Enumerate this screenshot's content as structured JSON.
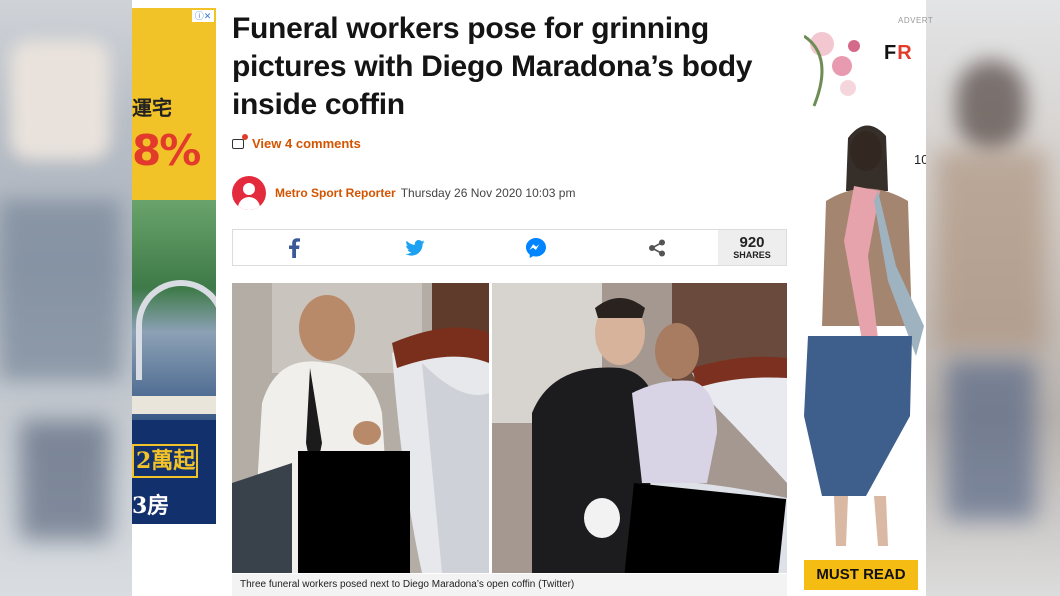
{
  "article": {
    "headline": "Funeral workers pose for grinning pictures with Diego Maradona’s body inside coffin",
    "comments_link": "View 4 comments",
    "author": "Metro Sport Reporter",
    "date": "Thursday 26 Nov 2020 10:03 pm",
    "share_count": "920",
    "share_label": "SHARES",
    "share_buttons": [
      "facebook-icon",
      "twitter-icon",
      "messenger-icon",
      "share-icon"
    ],
    "caption": "Three funeral workers posed next to Diego Maradona’s open coffin (Twitter)"
  },
  "ads": {
    "left": {
      "adchoices": "ⓘ✕",
      "line1": "運宅",
      "percent": "8%",
      "price_text": "2萬起",
      "rooms_text": "3房"
    },
    "right": {
      "label": "ADVERT",
      "brand_prefix": "F",
      "brand_suffix": "R",
      "side_text": "10",
      "cta": "MUST READ"
    }
  },
  "colors": {
    "accent": "#d35400",
    "avatar_red": "#e32b3d",
    "facebook": "#3b5998",
    "twitter": "#1da1f2",
    "messenger": "#0084ff",
    "cta_yellow": "#f5bd14"
  }
}
